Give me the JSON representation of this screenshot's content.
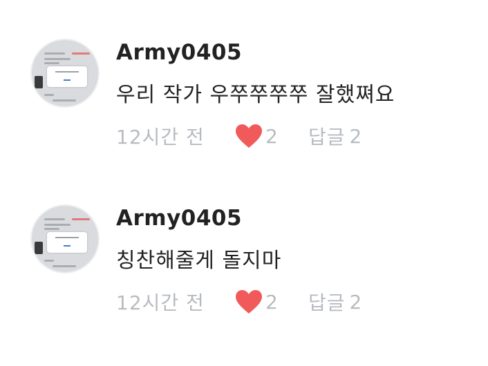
{
  "accent_heart_color": "#f05a5a",
  "meta_text_color": "#b7bbc0",
  "comments": [
    {
      "username": "Army0405",
      "text": "우리 작가 우쭈쭈쭈쭈 잘했쪄요",
      "time": "12시간 전",
      "likes": "2",
      "reply_label": "답글",
      "reply_count": "2"
    },
    {
      "username": "Army0405",
      "text": "칭찬해줄게 돌지마",
      "time": "12시간 전",
      "likes": "2",
      "reply_label": "답글",
      "reply_count": "2"
    }
  ]
}
